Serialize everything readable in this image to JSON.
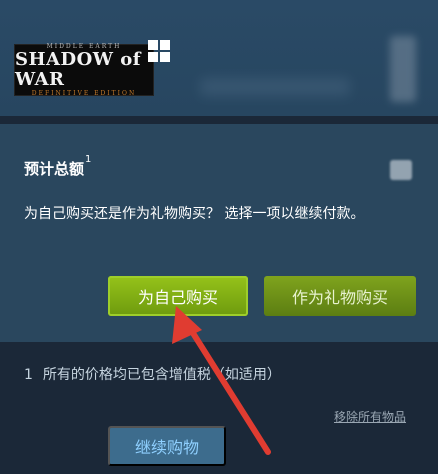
{
  "product": {
    "capsule_top": "MIDDLE EARTH",
    "capsule_title": "SHADOW of WAR",
    "capsule_sub": "DEFINITIVE EDITION",
    "platform_icon": "windows-icon"
  },
  "summary": {
    "total_label": "预计总额",
    "footnote_marker": "1",
    "prompt": "为自己购买还是作为礼物购买？ 选择一项以继续付款。",
    "buy_self_label": "为自己购买",
    "buy_gift_label": "作为礼物购买"
  },
  "footer": {
    "note_number": "1",
    "note_text": "所有的价格均已包含增值税（如适用）",
    "remove_all_label": "移除所有物品",
    "continue_label": "继续购物"
  },
  "colors": {
    "background": "#1b2838",
    "panel": "#2a475e",
    "green_button": "#7fa31d",
    "annotation_arrow": "#e03c31"
  }
}
